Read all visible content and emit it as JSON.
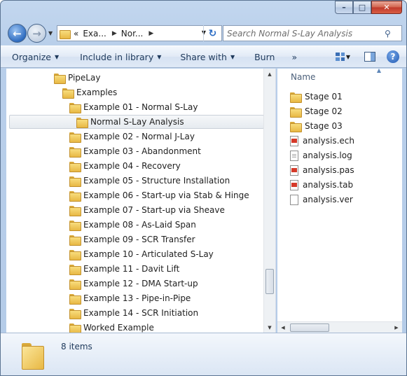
{
  "window": {
    "caption": {
      "minimize": "–",
      "maximize": "□",
      "close": "✕"
    }
  },
  "address": {
    "overflow": "«",
    "segments": [
      "Exa...",
      "Nor..."
    ],
    "search_placeholder": "Search Normal S-Lay Analysis"
  },
  "toolbar": {
    "items": [
      "Organize",
      "Include in library",
      "Share with",
      "Burn"
    ],
    "more": "»"
  },
  "tree": {
    "items": [
      {
        "label": "PipeLay",
        "level": 0
      },
      {
        "label": "Examples",
        "level": 1
      },
      {
        "label": "Example 01 - Normal S-Lay",
        "level": 2
      },
      {
        "label": "Normal S-Lay Analysis",
        "level": 3,
        "selected": true
      },
      {
        "label": "Example 02 - Normal J-Lay",
        "level": 2
      },
      {
        "label": "Example 03 - Abandonment",
        "level": 2
      },
      {
        "label": "Example 04 - Recovery",
        "level": 2
      },
      {
        "label": "Example 05 - Structure Installation",
        "level": 2
      },
      {
        "label": "Example 06 - Start-up via Stab & Hinge",
        "level": 2
      },
      {
        "label": "Example 07 - Start-up via Sheave",
        "level": 2
      },
      {
        "label": "Example 08 - As-Laid Span",
        "level": 2
      },
      {
        "label": "Example 09 - SCR Transfer",
        "level": 2
      },
      {
        "label": "Example 10 - Articulated S-Lay",
        "level": 2
      },
      {
        "label": "Example 11 - Davit Lift",
        "level": 2
      },
      {
        "label": "Example 12 - DMA Start-up",
        "level": 2
      },
      {
        "label": "Example 13 - Pipe-in-Pipe",
        "level": 2
      },
      {
        "label": "Example 14 - SCR Initiation",
        "level": 2
      },
      {
        "label": "Worked Example",
        "level": 2
      }
    ]
  },
  "files": {
    "column_name": "Name",
    "items": [
      {
        "label": "Stage 01",
        "icon": "folder-icon"
      },
      {
        "label": "Stage 02",
        "icon": "folder-icon"
      },
      {
        "label": "Stage 03",
        "icon": "folder-icon"
      },
      {
        "label": "analysis.ech",
        "icon": "pdf-file-icon"
      },
      {
        "label": "analysis.log",
        "icon": "text-file-icon"
      },
      {
        "label": "analysis.pas",
        "icon": "pdf-file-icon"
      },
      {
        "label": "analysis.tab",
        "icon": "pdf-file-icon"
      },
      {
        "label": "analysis.ver",
        "icon": "blank-file-icon"
      }
    ]
  },
  "details": {
    "count": "8 items"
  }
}
